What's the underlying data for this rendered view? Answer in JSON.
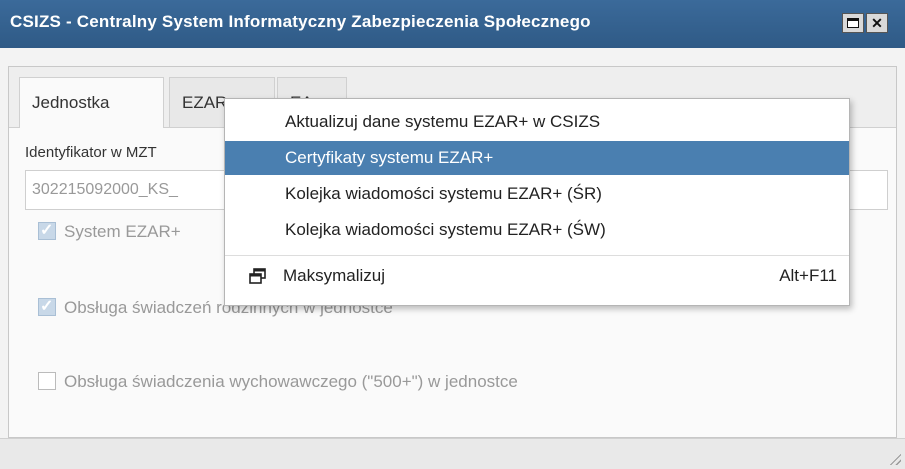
{
  "window": {
    "title": "CSIZS - Centralny System Informatyczny Zabezpieczenia Społecznego",
    "maximize_icon": "window-maximize-icon",
    "close_icon": "close-icon"
  },
  "tabs": [
    {
      "label": "Jednostka"
    },
    {
      "label": "EZAR+"
    },
    {
      "label": "EA+"
    }
  ],
  "form": {
    "identifier_label": "Identyfikator w MZT",
    "identifier_value": "302215092000_KS_",
    "system_ezar_label": "System EZAR+",
    "family_benefits_label": "Obsługa świadczeń rodzinnych w jednostce",
    "child_benefit_label": "Obsługa świadczenia wychowawczego (\"500+\") w jednostce"
  },
  "menu": {
    "items": [
      {
        "label": "Aktualizuj dane systemu EZAR+ w CSIZS"
      },
      {
        "label": "Certyfikaty systemu EZAR+"
      },
      {
        "label": "Kolejka wiadomości systemu EZAR+ (ŚR)"
      },
      {
        "label": "Kolejka wiadomości systemu EZAR+ (ŚW)"
      }
    ],
    "maximize": {
      "label": "Maksymalizuj",
      "shortcut": "Alt+F11",
      "icon": "restore-window-icon"
    }
  },
  "colors": {
    "titlebar": "#2f5a86",
    "menu_highlight": "#4a7fb0"
  }
}
